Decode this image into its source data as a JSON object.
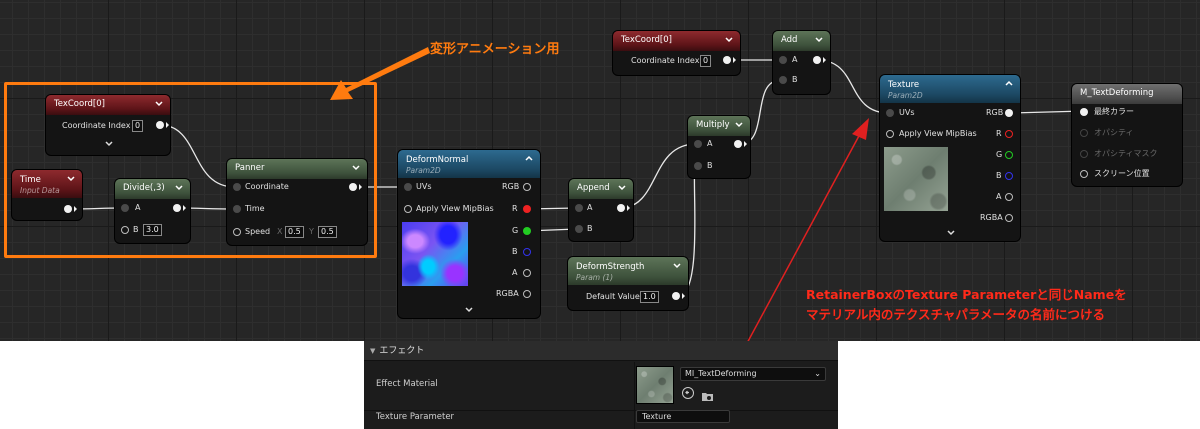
{
  "nodes": {
    "texcoord_left": {
      "title": "TexCoord[0]",
      "coord_label": "Coordinate Index",
      "coord_value": "0"
    },
    "time": {
      "title": "Time",
      "subtitle": "Input Data"
    },
    "divide": {
      "title": "Divide(,3)",
      "pin_a": "A",
      "pin_b": "B",
      "b_value": "3.0"
    },
    "panner": {
      "title": "Panner",
      "coordinate": "Coordinate",
      "time": "Time",
      "speed": "Speed",
      "x_label": "X",
      "x_value": "0.5",
      "y_label": "Y",
      "y_value": "0.5"
    },
    "deform_normal": {
      "title": "DeformNormal",
      "subtitle": "Param2D",
      "uvs": "UVs",
      "mip": "Apply View MipBias",
      "rgb": "RGB",
      "r": "R",
      "g": "G",
      "b": "B",
      "a": "A",
      "rgba": "RGBA"
    },
    "append": {
      "title": "Append",
      "pin_a": "A",
      "pin_b": "B"
    },
    "texcoord_top": {
      "title": "TexCoord[0]",
      "coord_label": "Coordinate Index",
      "coord_value": "0"
    },
    "add": {
      "title": "Add",
      "pin_a": "A",
      "pin_b": "B"
    },
    "multiply": {
      "title": "Multiply",
      "pin_a": "A",
      "pin_b": "B"
    },
    "deform_strength": {
      "title": "DeformStrength",
      "subtitle": "Param (1)",
      "label": "Default Value",
      "value": "1.0"
    },
    "texture": {
      "title": "Texture",
      "subtitle": "Param2D",
      "uvs": "UVs",
      "mip": "Apply View MipBias",
      "rgb": "RGB",
      "r": "R",
      "g": "G",
      "b": "B",
      "a": "A",
      "rgba": "RGBA"
    },
    "result": {
      "title": "M_TextDeforming",
      "base_color": "最終カラー",
      "opacity": "オパシティ",
      "opacity_mask": "オパシティマスク",
      "screen_pos": "スクリーン位置"
    }
  },
  "annotations": {
    "orange_label": "変形アニメーション用",
    "red_line1": "RetainerBoxのTexture ParameterとNameを",
    "red_line1_full": "RetainerBoxのTexture Parameterと同じNameを",
    "red_line2": "マテリアル内のテクスチャパラメータの名前につける"
  },
  "panel": {
    "header": "エフェクト",
    "effect_material_label": "Effect Material",
    "effect_material_value": "MI_TextDeforming",
    "texture_parameter_label": "Texture Parameter",
    "texture_parameter_value": "Texture"
  },
  "colors": {
    "orange": "#ff7b0f",
    "red_annotation": "#ff2a1a",
    "graph_bg": "#262626"
  }
}
